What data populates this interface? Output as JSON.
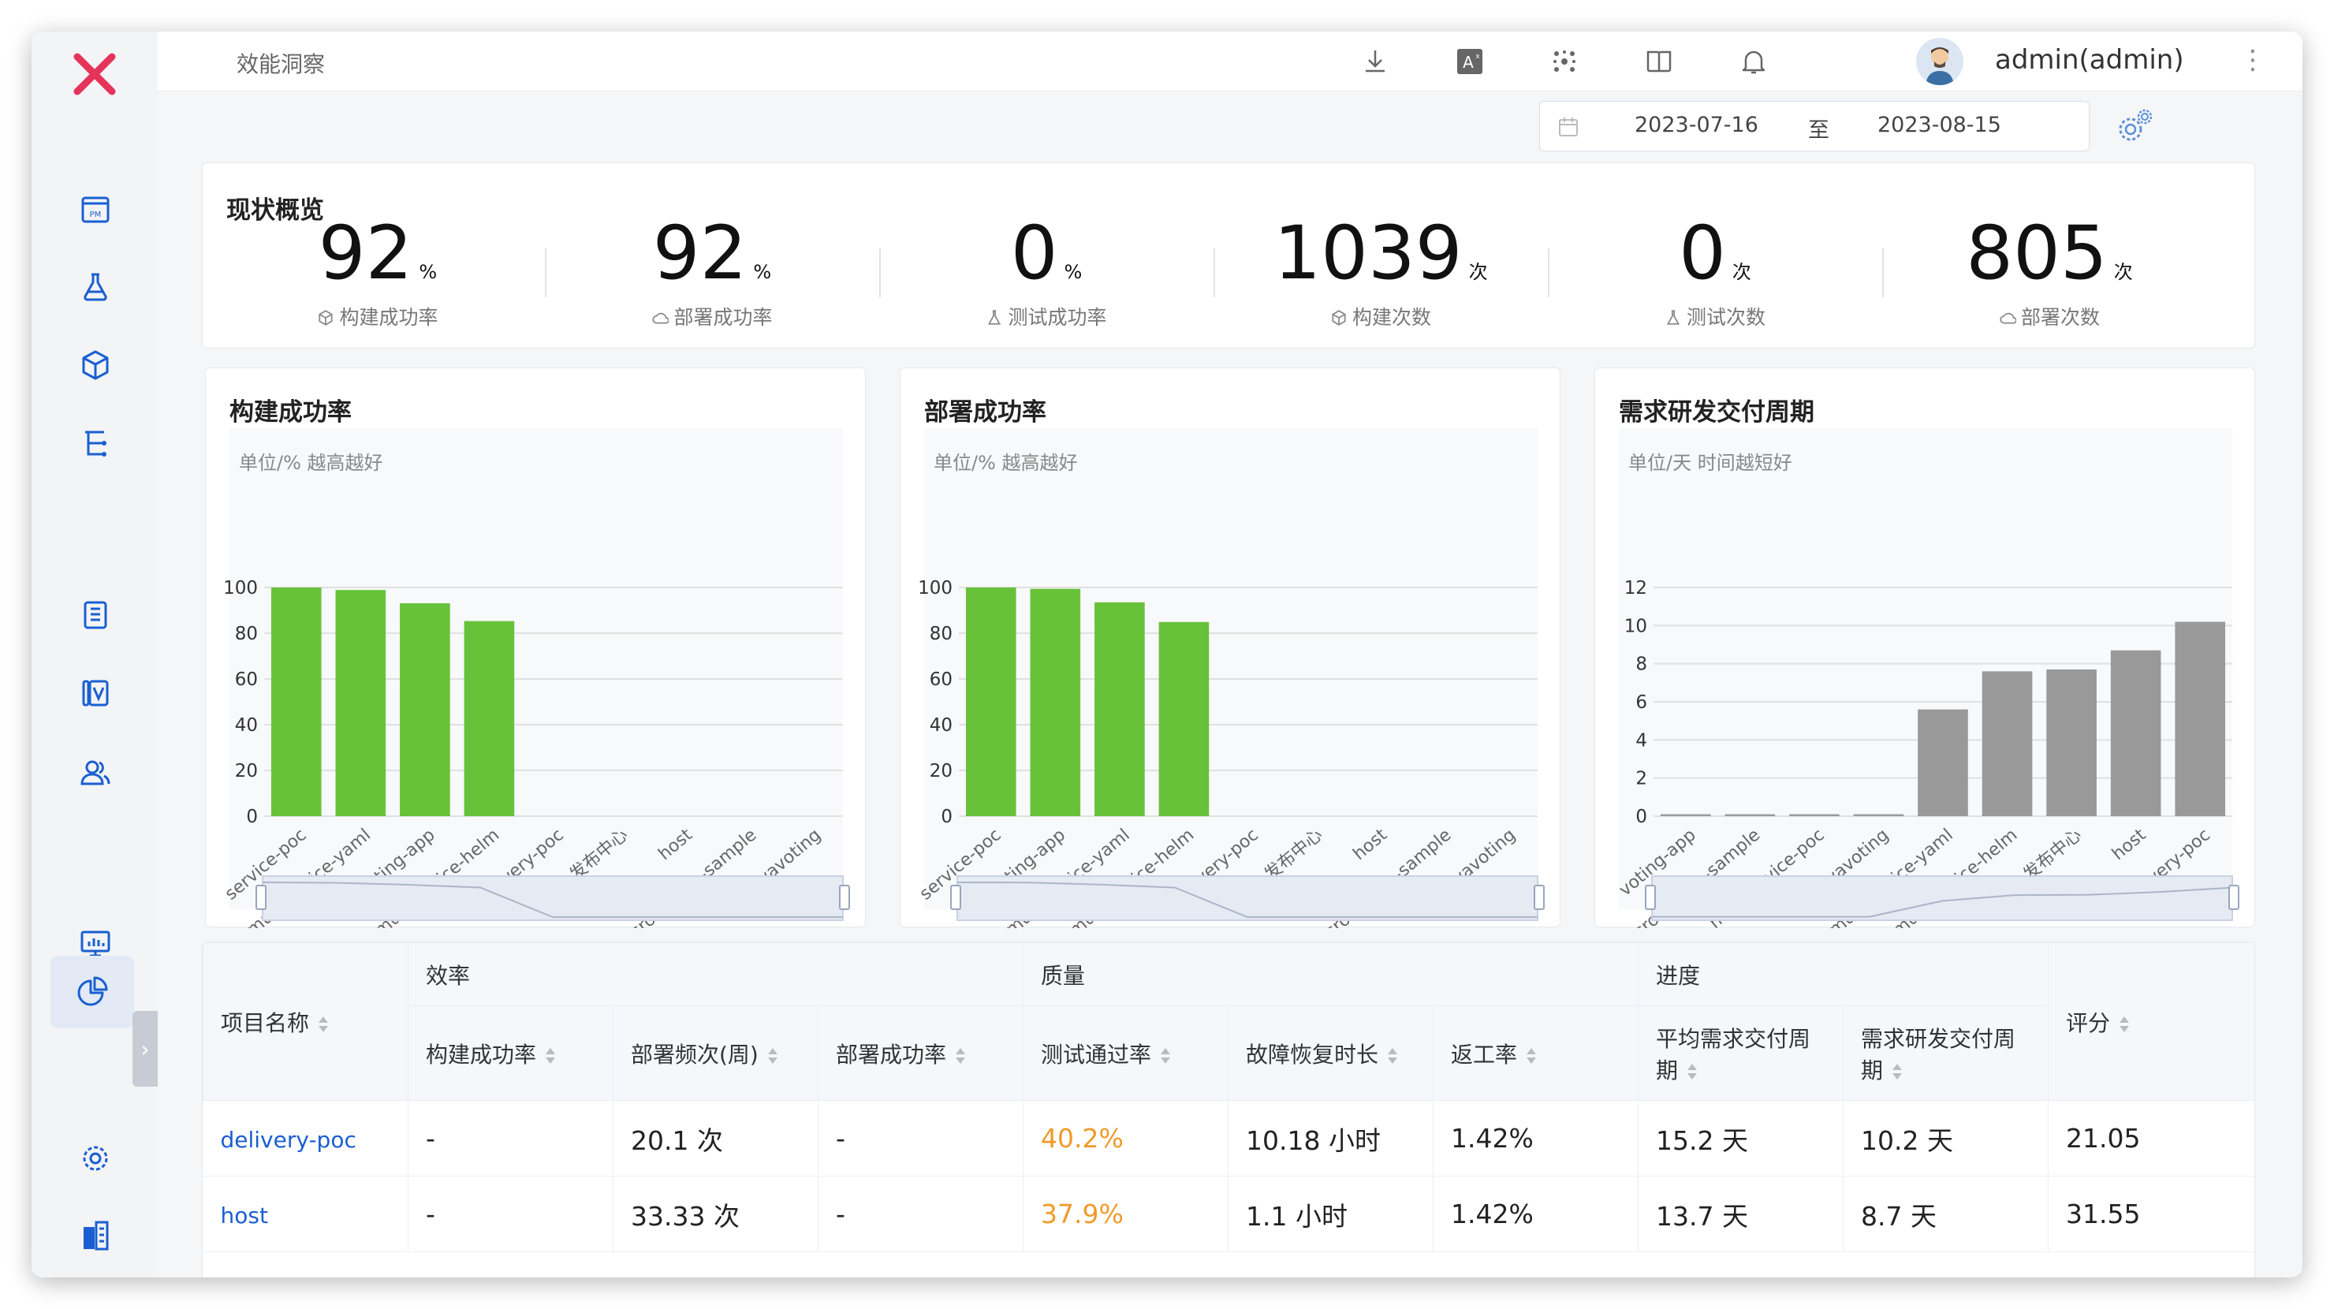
{
  "breadcrumb": "效能洞察",
  "user": {
    "name": "admin(admin)"
  },
  "date_range": {
    "start": "2023-07-16",
    "separator": "至",
    "end": "2023-08-15"
  },
  "overview": {
    "title": "现状概览",
    "stats": [
      {
        "value": "92",
        "unit": "%",
        "label": "构建成功率",
        "icon": "cube-icon"
      },
      {
        "value": "92",
        "unit": "%",
        "label": "部署成功率",
        "icon": "cloud-icon"
      },
      {
        "value": "0",
        "unit": "%",
        "label": "测试成功率",
        "icon": "flask-icon"
      },
      {
        "value": "1039",
        "unit": "次",
        "label": "构建次数",
        "icon": "cube-icon"
      },
      {
        "value": "0",
        "unit": "次",
        "label": "测试次数",
        "icon": "flask-icon"
      },
      {
        "value": "805",
        "unit": "次",
        "label": "部署次数",
        "icon": "cloud-icon"
      }
    ]
  },
  "chart_data": [
    {
      "type": "bar",
      "title": "构建成功率",
      "subtitle": "单位/% 越高越好",
      "categories": [
        "service-poc",
        "multiservice-yaml",
        "voting-app",
        "multiservice-helm",
        "delivery-poc",
        "发布中心",
        "host",
        "microservice-sample",
        "javavoting"
      ],
      "values": [
        100,
        98.9,
        93.1,
        85.3,
        0,
        0,
        0,
        0,
        0
      ],
      "ylim": [
        0,
        100
      ],
      "yticks": [
        0,
        20,
        40,
        60,
        80,
        100
      ],
      "color": "#67c23a",
      "grid": true
    },
    {
      "type": "bar",
      "title": "部署成功率",
      "subtitle": "单位/% 越高越好",
      "categories": [
        "service-poc",
        "voting-app",
        "multiservice-yaml",
        "multiservice-helm",
        "delivery-poc",
        "发布中心",
        "host",
        "microservice-sample",
        "javavoting"
      ],
      "values": [
        100,
        99.4,
        93.5,
        84.9,
        0,
        0,
        0,
        0,
        0
      ],
      "ylim": [
        0,
        100
      ],
      "yticks": [
        0,
        20,
        40,
        60,
        80,
        100
      ],
      "color": "#67c23a",
      "grid": true
    },
    {
      "type": "bar",
      "title": "需求研发交付周期",
      "subtitle": "单位/天 时间越短好",
      "categories": [
        "voting-app",
        "microservice-sample",
        "multiservice-poc",
        "javavoting",
        "multiservice-yaml",
        "multiservice-helm",
        "发布中心",
        "host",
        "delivery-poc"
      ],
      "values": [
        0.1,
        0.1,
        0.1,
        0.1,
        5.6,
        7.6,
        7.7,
        8.7,
        10.2
      ],
      "ylim": [
        0,
        12
      ],
      "yticks": [
        0,
        2,
        4,
        6,
        8,
        10,
        12
      ],
      "color": "#999999",
      "grid": true
    }
  ],
  "table": {
    "group_headers": [
      "效率",
      "质量",
      "进度"
    ],
    "col_project": "项目名称",
    "col_score": "评分",
    "columns": [
      "构建成功率",
      "部署频次(周)",
      "部署成功率",
      "测试通过率",
      "故障恢复时长",
      "返工率",
      "平均需求交付周期",
      "需求研发交付周期"
    ],
    "rows": [
      {
        "name": "delivery-poc",
        "cells": [
          "-",
          "20.1 次",
          "-",
          "40.2%",
          "10.18 小时",
          "1.42%",
          "15.2 天",
          "10.2 天"
        ],
        "score": "21.05"
      },
      {
        "name": "host",
        "cells": [
          "-",
          "33.33 次",
          "-",
          "37.9%",
          "1.1 小时",
          "1.42%",
          "13.7 天",
          "8.7 天"
        ],
        "score": "31.55"
      }
    ]
  },
  "colors": {
    "accent": "#1a5fd1",
    "success": "#67c23a",
    "warn": "#f09a2a",
    "logo": "#e6335a"
  }
}
